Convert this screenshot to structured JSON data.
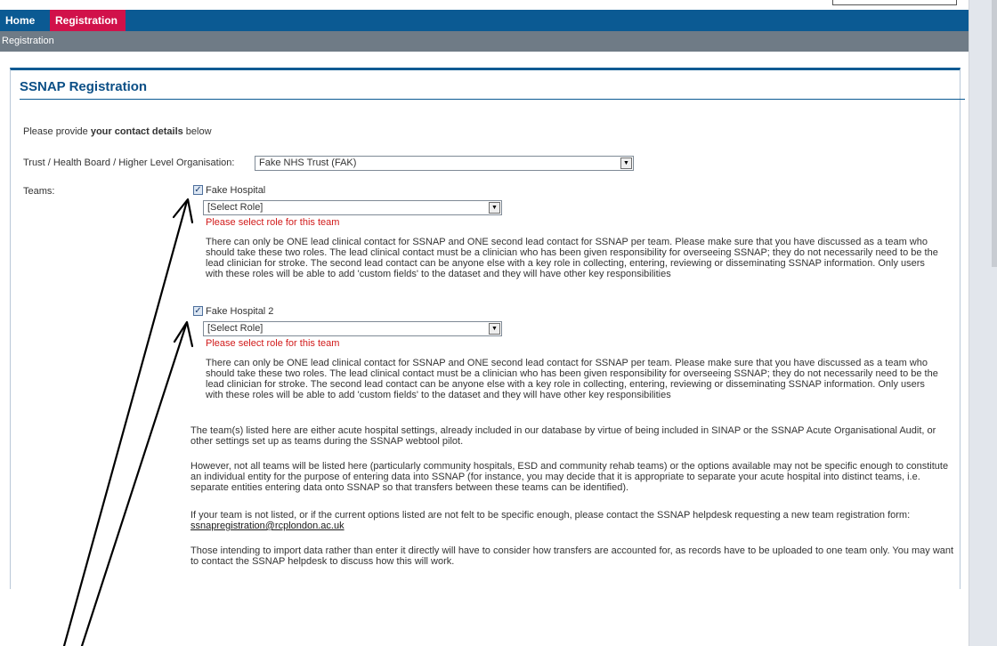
{
  "nav": {
    "home_label": "Home",
    "registration_label": "Registration",
    "breadcrumb": "Registration"
  },
  "panel": {
    "title": "SSNAP Registration"
  },
  "form": {
    "intro_prefix": "Please provide ",
    "intro_bold": "your contact details",
    "intro_suffix": " below",
    "trust_label": "Trust / Health Board / Higher Level Organisation:",
    "trust_value": "Fake NHS Trust (FAK)",
    "teams_label": "Teams:"
  },
  "teams": [
    {
      "name": "Fake Hospital",
      "checked": true,
      "role_value": "[Select Role]",
      "error": "Please select role for this team",
      "info": "There can only be ONE lead clinical contact for SSNAP and ONE second lead contact for SSNAP per team. Please make sure that you have discussed as a team who should take these two roles. The lead clinical contact must be a clinician who has been given responsibility for overseeing SSNAP; they do not necessarily need to be the lead clinician for stroke. The second lead contact can be anyone else with a key role in collecting, entering, reviewing or disseminating SSNAP information. Only users with these roles will be able to add 'custom fields' to the dataset and they will have other key responsibilities"
    },
    {
      "name": "Fake Hospital 2",
      "checked": true,
      "role_value": "[Select Role]",
      "error": "Please select role for this team",
      "info": "There can only be ONE lead clinical contact for SSNAP and ONE second lead contact for SSNAP per team. Please make sure that you have discussed as a team who should take these two roles. The lead clinical contact must be a clinician who has been given responsibility for overseeing SSNAP; they do not necessarily need to be the lead clinician for stroke. The second lead contact can be anyone else with a key role in collecting, entering, reviewing or disseminating SSNAP information. Only users with these roles will be able to add 'custom fields' to the dataset and they will have other key responsibilities"
    }
  ],
  "notes": {
    "p1": "The team(s) listed here are either acute hospital settings, already included in our database by virtue of being included in SINAP or the SSNAP Acute Organisational Audit, or other settings set up as teams during the SSNAP webtool pilot.",
    "p2": "However, not all teams will be listed here (particularly community hospitals, ESD and community rehab teams) or the options available may not be specific enough to constitute an individual entity for the purpose of entering data into SSNAP (for instance, you may decide that it is appropriate to separate your acute hospital into distinct teams, i.e. separate entities entering data onto SSNAP so that transfers between these teams can be identified).",
    "p3": "If your team is not listed, or if the current options listed are not felt to be specific enough, please contact the SSNAP helpdesk requesting a new team registration form: ",
    "p3_email": "ssnapregistration@rcplondon.ac.uk",
    "p4": "Those intending to import data rather than enter it directly will have to consider how transfers are accounted for, as records have to be uploaded to one team only. You may want to contact the SSNAP helpdesk to discuss how this will work."
  },
  "colors": {
    "nav_blue": "#0b5a93",
    "active_tab": "#d1114a",
    "subbar": "#6f7b86",
    "error_red": "#d11a1a"
  },
  "icons": {
    "checkbox": "checked-checkbox-icon",
    "dropdown": "chevron-down-icon",
    "annotation": "arrow-icon"
  }
}
